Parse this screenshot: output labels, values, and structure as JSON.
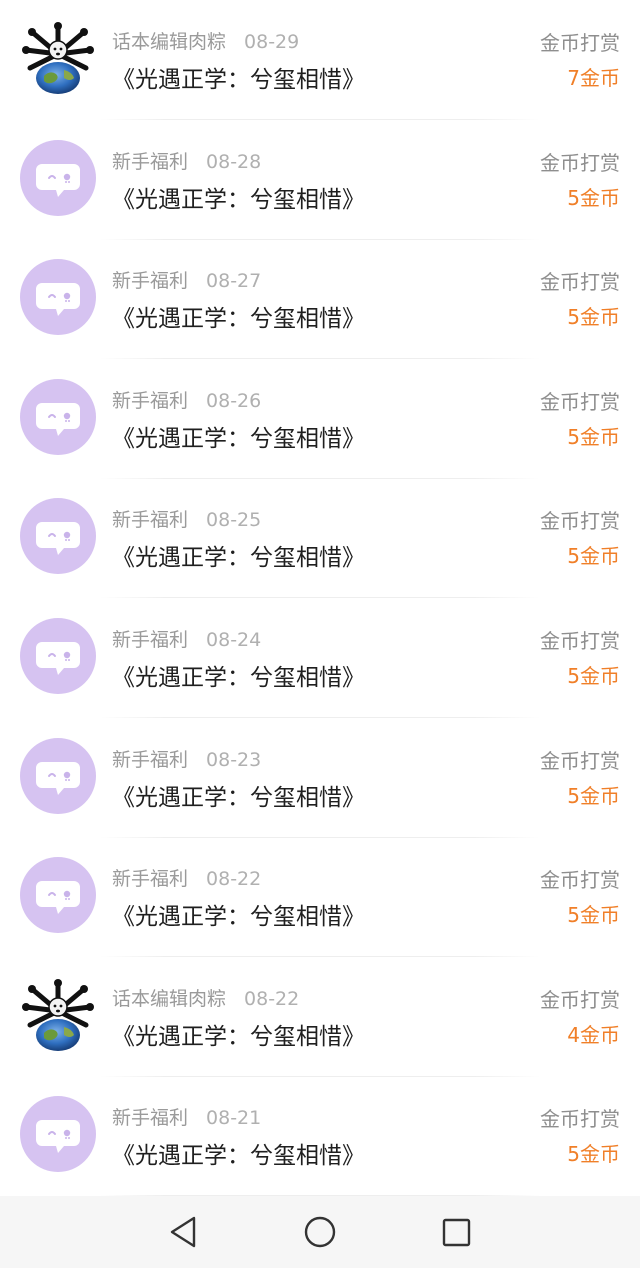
{
  "colors": {
    "bot_avatar_bg": "#d6c3f1",
    "amount_orange": "#f07f28",
    "meta_gray": "#9a9a9a",
    "title_black": "#1f1f1f"
  },
  "records": [
    {
      "avatar": "editor-avatar-icon",
      "sender": "话本编辑肉粽",
      "date": "08-29",
      "book": "《光遇正学：兮玺相惜》",
      "label": "金币打赏",
      "amount": "7金币"
    },
    {
      "avatar": "chat-bubble-icon",
      "sender": "新手福利",
      "date": "08-28",
      "book": "《光遇正学：兮玺相惜》",
      "label": "金币打赏",
      "amount": "5金币"
    },
    {
      "avatar": "chat-bubble-icon",
      "sender": "新手福利",
      "date": "08-27",
      "book": "《光遇正学：兮玺相惜》",
      "label": "金币打赏",
      "amount": "5金币"
    },
    {
      "avatar": "chat-bubble-icon",
      "sender": "新手福利",
      "date": "08-26",
      "book": "《光遇正学：兮玺相惜》",
      "label": "金币打赏",
      "amount": "5金币"
    },
    {
      "avatar": "chat-bubble-icon",
      "sender": "新手福利",
      "date": "08-25",
      "book": "《光遇正学：兮玺相惜》",
      "label": "金币打赏",
      "amount": "5金币"
    },
    {
      "avatar": "chat-bubble-icon",
      "sender": "新手福利",
      "date": "08-24",
      "book": "《光遇正学：兮玺相惜》",
      "label": "金币打赏",
      "amount": "5金币"
    },
    {
      "avatar": "chat-bubble-icon",
      "sender": "新手福利",
      "date": "08-23",
      "book": "《光遇正学：兮玺相惜》",
      "label": "金币打赏",
      "amount": "5金币"
    },
    {
      "avatar": "chat-bubble-icon",
      "sender": "新手福利",
      "date": "08-22",
      "book": "《光遇正学：兮玺相惜》",
      "label": "金币打赏",
      "amount": "5金币"
    },
    {
      "avatar": "editor-avatar-icon",
      "sender": "话本编辑肉粽",
      "date": "08-22",
      "book": "《光遇正学：兮玺相惜》",
      "label": "金币打赏",
      "amount": "4金币"
    },
    {
      "avatar": "chat-bubble-icon",
      "sender": "新手福利",
      "date": "08-21",
      "book": "《光遇正学：兮玺相惜》",
      "label": "金币打赏",
      "amount": "5金币"
    }
  ],
  "navbar": {
    "back": "back-triangle-icon",
    "home": "home-circle-icon",
    "recents": "recents-square-icon"
  }
}
